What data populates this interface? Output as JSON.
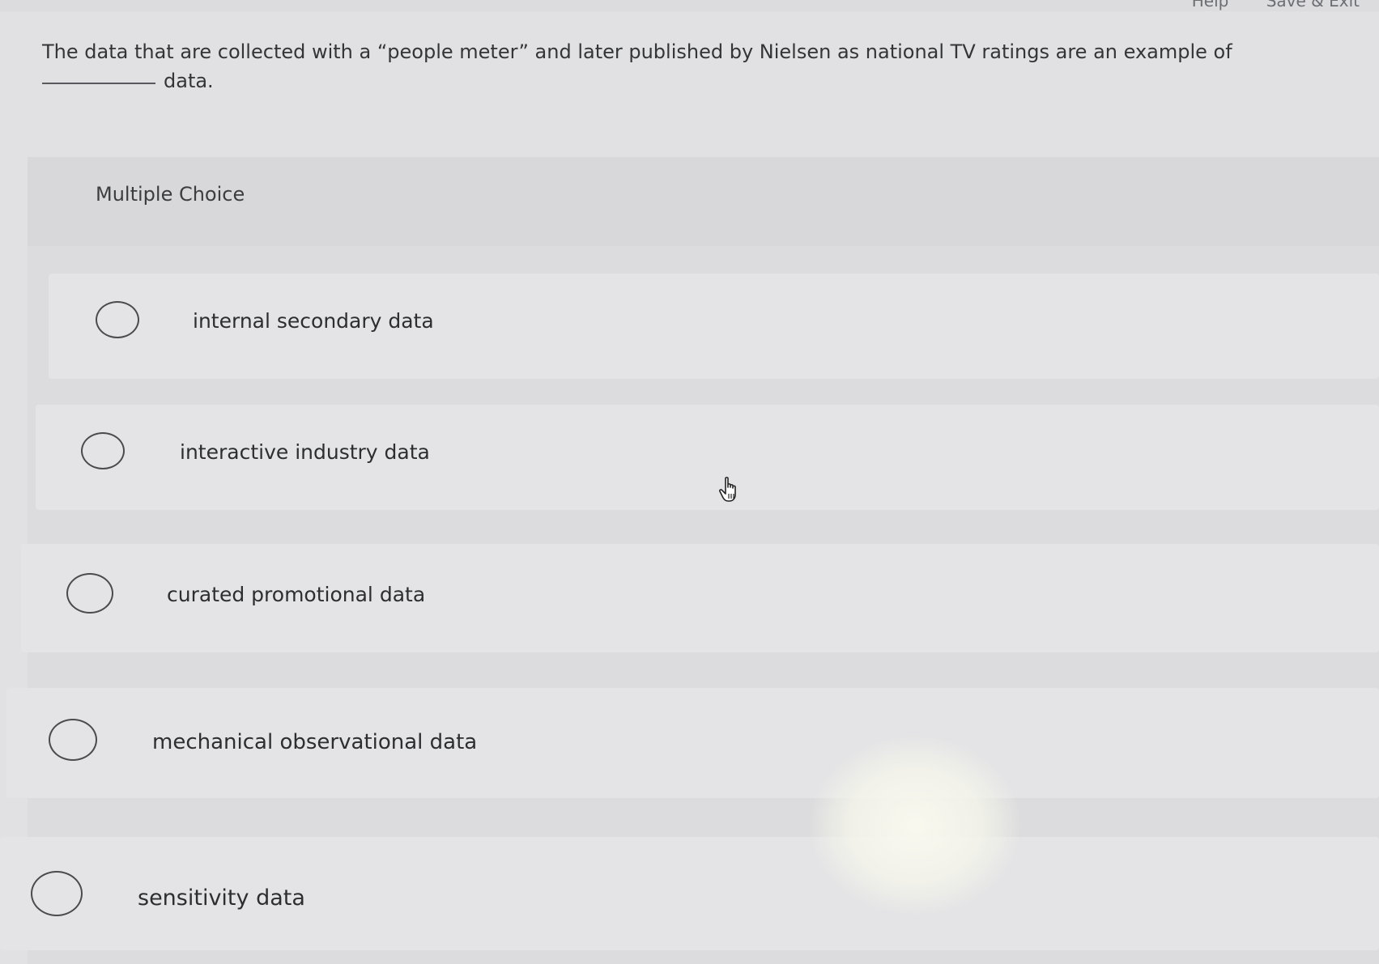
{
  "top_bar": {
    "links": [
      "Help",
      "Save & Exit"
    ]
  },
  "question": {
    "text_line1": "The data that are collected with a “people meter” and later published by Nielsen as national TV ratings are an example of",
    "text_line2": "data."
  },
  "multiple_choice": {
    "label": "Multiple Choice",
    "options": [
      {
        "label": "internal secondary data",
        "selected": false
      },
      {
        "label": "interactive industry data",
        "selected": false
      },
      {
        "label": "curated promotional data",
        "selected": false
      },
      {
        "label": "mechanical observational data",
        "selected": false
      },
      {
        "label": "sensitivity data",
        "selected": false
      }
    ]
  },
  "icons": {
    "cursor": "hand-pointer-icon",
    "radio": "radio-unselected-icon"
  },
  "colors": {
    "background": "#e1e1e3",
    "text": "#2d2e31",
    "radio_border": "#4a4b4f"
  }
}
